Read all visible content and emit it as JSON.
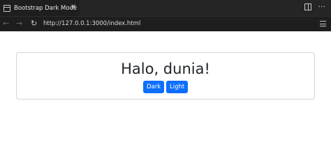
{
  "tab": {
    "title": "Bootstrap Dark Mode",
    "close_glyph": "✕",
    "page_icon": "page-icon"
  },
  "tab_actions": {
    "split_icon": "split-editor-icon",
    "more_glyph": "···"
  },
  "navbar": {
    "back_glyph": "←",
    "forward_glyph": "→",
    "reload_glyph": "↻",
    "url": "http://127.0.0.1:3000/index.html",
    "menu_icon": "hamburger-menu-icon"
  },
  "page": {
    "heading": "Halo, dunia!",
    "buttons": {
      "dark_label": "Dark",
      "light_label": "Light"
    }
  },
  "colors": {
    "button_primary": "#0d6efd",
    "tab_bar": "#252526",
    "active_tab": "#1e1e1e",
    "heading_text": "#212529"
  }
}
